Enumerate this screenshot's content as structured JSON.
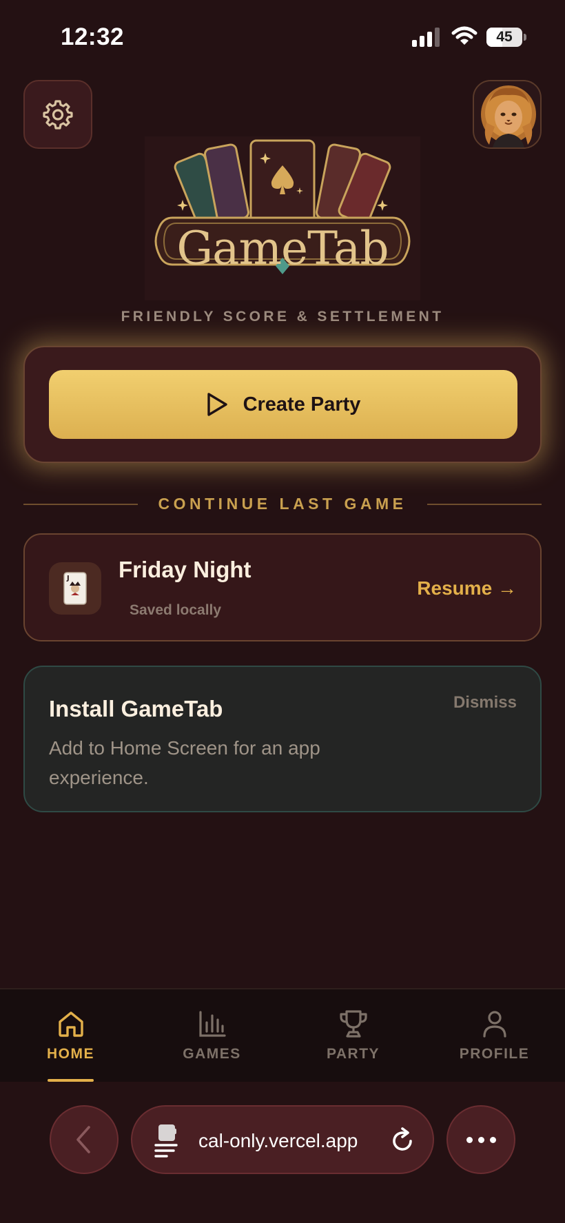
{
  "status_bar": {
    "time": "12:32",
    "battery_level": "45",
    "battery_fraction": 0.45
  },
  "header": {
    "settings_icon": "gear-icon",
    "avatar_icon": "lion-avatar"
  },
  "logo": {
    "title": "GameTab",
    "tagline": "FRIENDLY SCORE & SETTLEMENT"
  },
  "create_party": {
    "label": "Create Party",
    "icon": "play-icon"
  },
  "continue_section": {
    "title": "CONTINUE LAST GAME",
    "game_name": "Friday Night",
    "subtitle": "Saved locally",
    "resume_label": "Resume →",
    "icon": "joker-card-icon"
  },
  "install_banner": {
    "title": "Install GameTab",
    "description": "Add to Home Screen for an app experience.",
    "dismiss_label": "Dismiss"
  },
  "tab_bar": {
    "items": [
      {
        "label": "HOME",
        "icon": "home-icon",
        "active": true
      },
      {
        "label": "GAMES",
        "icon": "bar-chart-icon",
        "active": false
      },
      {
        "label": "PARTY",
        "icon": "trophy-icon",
        "active": false
      },
      {
        "label": "PROFILE",
        "icon": "person-icon",
        "active": false
      }
    ]
  },
  "browser": {
    "url": "cal-only.vercel.app"
  },
  "colors": {
    "accent": "#e3b04a",
    "background": "#241113",
    "button_gold": "#f1cf6f"
  }
}
